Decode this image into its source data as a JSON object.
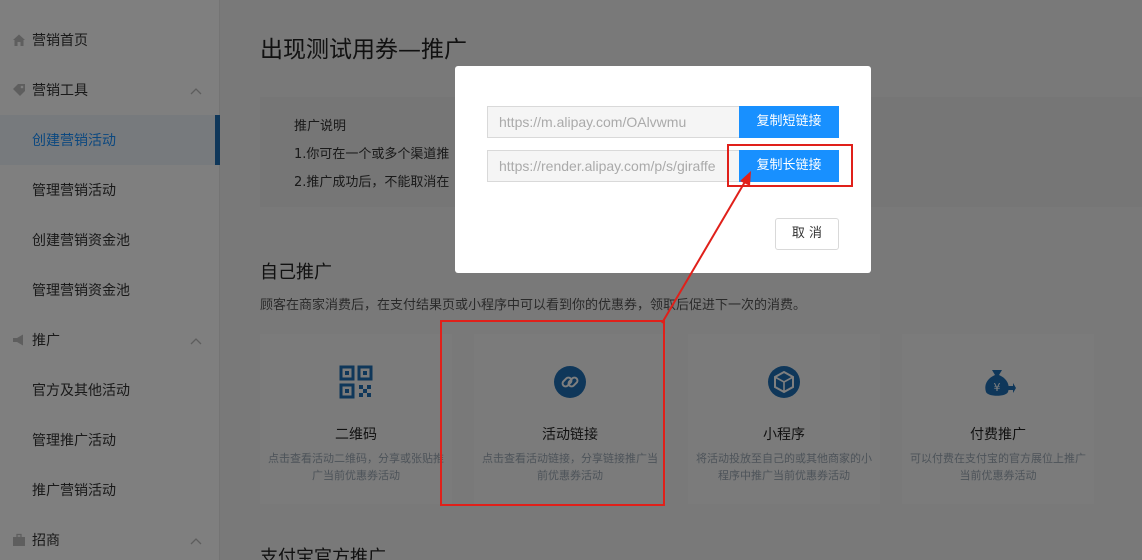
{
  "sidebar": {
    "items": [
      {
        "label": "营销首页",
        "icon": "home-icon",
        "type": "group"
      },
      {
        "label": "营销工具",
        "icon": "tag-icon",
        "type": "group",
        "expanded": true
      },
      {
        "label": "创建营销活动",
        "type": "sub",
        "active": true
      },
      {
        "label": "管理营销活动",
        "type": "sub"
      },
      {
        "label": "创建营销资金池",
        "type": "sub"
      },
      {
        "label": "管理营销资金池",
        "type": "sub"
      },
      {
        "label": "推广",
        "icon": "megaphone-icon",
        "type": "group",
        "expanded": true
      },
      {
        "label": "官方及其他活动",
        "type": "sub"
      },
      {
        "label": "管理推广活动",
        "type": "sub"
      },
      {
        "label": "推广营销活动",
        "type": "sub"
      },
      {
        "label": "招商",
        "icon": "briefcase-icon",
        "type": "group",
        "expanded": true
      }
    ]
  },
  "main": {
    "title": "出现测试用券—推广",
    "note": {
      "title": "推广说明",
      "line1": "1.你可在一个或多个渠道推",
      "line2": "2.推广成功后，不能取消在"
    },
    "section1": {
      "title": "自己推广",
      "desc": "顾客在商家消费后，在支付结果页或小程序中可以看到你的优惠券，领取后促进下一次的消费。"
    },
    "cards": [
      {
        "title": "二维码",
        "desc": "点击查看活动二维码，分享或张贴推广当前优惠券活动",
        "icon": "qrcode-icon"
      },
      {
        "title": "活动链接",
        "desc": "点击查看活动链接，分享链接推广当前优惠券活动",
        "icon": "link-icon"
      },
      {
        "title": "小程序",
        "desc": "将活动投放至自己的或其他商家的小程序中推广当前优惠券活动",
        "icon": "mini-program-icon"
      },
      {
        "title": "付费推广",
        "desc": "可以付费在支付宝的官方展位上推广当前优惠券活动",
        "icon": "paid-promotion-icon"
      }
    ],
    "section2": {
      "title": "支付宝官方推广"
    }
  },
  "modal": {
    "short_link": "https://m.alipay.com/OAlvwmu",
    "copy_short_label": "复制短链接",
    "long_link": "https://render.alipay.com/p/s/giraffe",
    "copy_long_label": "复制长链接",
    "cancel_label": "取 消"
  },
  "colors": {
    "accent": "#1890ff",
    "active_bar": "#1f6fb5",
    "annotation_red": "#e0201a",
    "icon_blue": "#1f6fb5"
  }
}
